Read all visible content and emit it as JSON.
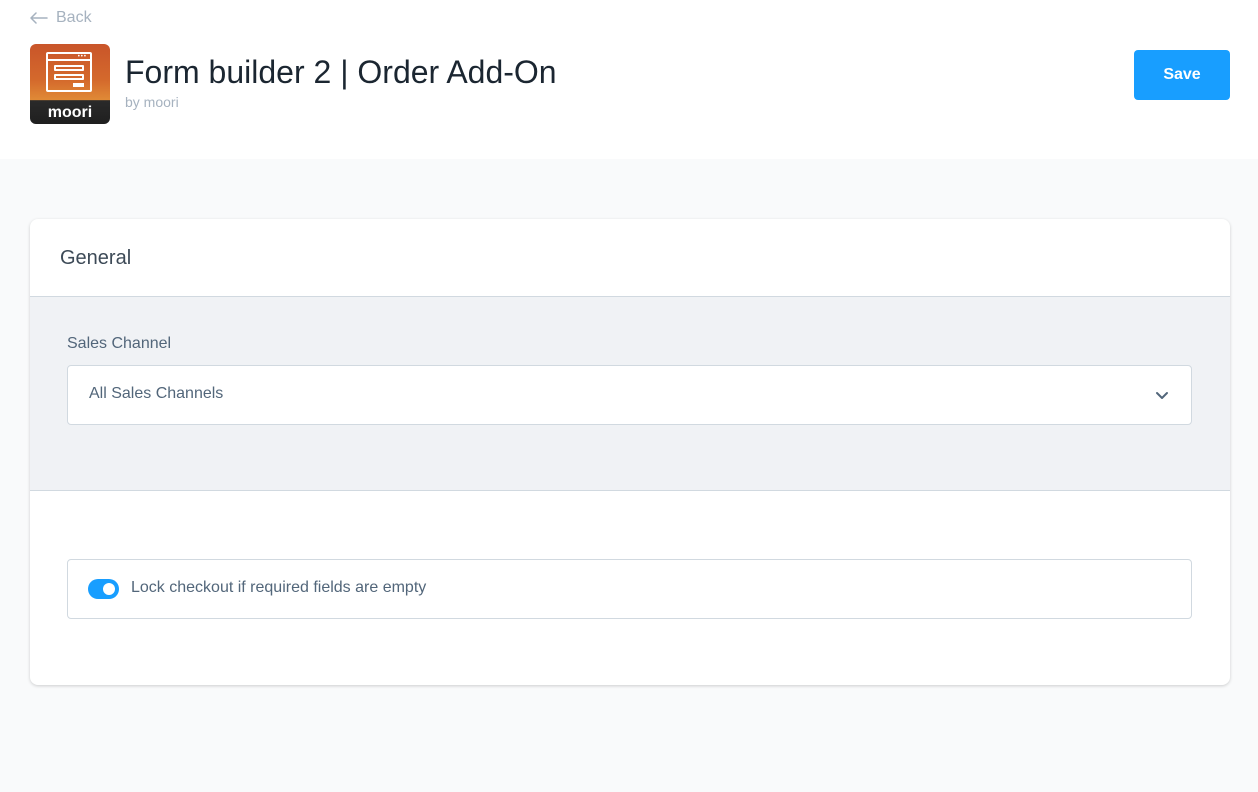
{
  "header": {
    "back_label": "Back",
    "app_title": "Form builder 2 | Order Add-On",
    "byline": "by moori",
    "icon_brand": "moori",
    "save_label": "Save"
  },
  "card": {
    "title": "General",
    "sales_channel": {
      "label": "Sales Channel",
      "value": "All Sales Channels"
    },
    "lock_checkout": {
      "label": "Lock checkout if required fields are empty",
      "enabled": true
    }
  },
  "colors": {
    "accent": "#189eff",
    "icon_orange": "#d4692c"
  },
  "icons": [
    "arrow-left-icon",
    "app-window-icon",
    "chevron-down-icon"
  ]
}
